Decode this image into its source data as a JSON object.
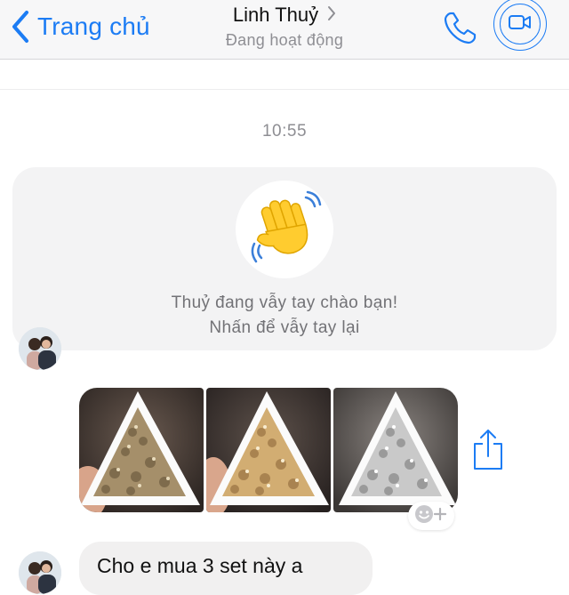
{
  "header": {
    "back_label": "Trang chủ",
    "contact_name": "Linh Thuỷ",
    "status": "Đang hoạt động",
    "accent_color": "#1c7cf4",
    "icons": [
      "chevron-left-icon",
      "chevron-right-icon",
      "phone-icon",
      "video-camera-icon"
    ]
  },
  "conversation": {
    "timestamp": "10:55",
    "wave_card": {
      "line1": "Thuỷ đang vẫy tay chào bạn!",
      "line2": "Nhấn để vẫy tay lại",
      "icon": "waving-hand-emoji"
    },
    "photo_message": {
      "photo_count": 3,
      "content": "triangular trays of crystal rhinestones",
      "icons": [
        "share-icon",
        "add-reaction-icon"
      ]
    },
    "text_message": {
      "text": "Cho e mua 3 set này a"
    }
  }
}
